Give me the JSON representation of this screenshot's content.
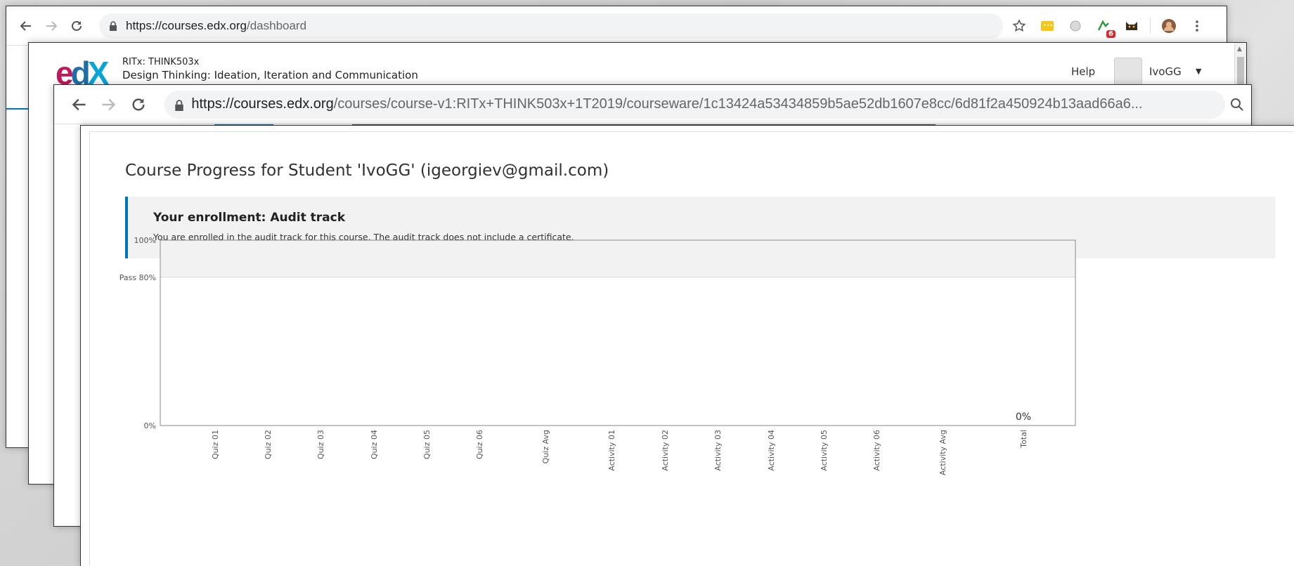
{
  "window1": {
    "url_host": "https://courses.edx.org",
    "url_path": "/dashboard"
  },
  "course_header": {
    "org_code": "RITx: THINK503x",
    "course_title": "Design Thinking: Ideation, Iteration and Communication",
    "help_label": "Help",
    "username": "IvoGG",
    "extension_badge": "6"
  },
  "window3": {
    "url_host": "https://courses.edx.org",
    "url_path": "/courses/course-v1:RITx+THINK503x+1T2019/courseware/1c13424a53434859b5ae52db1607e8cc/6d81f2a450924b13aad66a6..."
  },
  "progress_page": {
    "title": "Course Progress for Student 'IvoGG' (igeorgiev@gmail.com)",
    "enrollment_title": "Your enrollment: Audit track",
    "enrollment_text": "You are enrolled in the audit track for this course. The audit track does not include a certificate."
  },
  "chart_data": {
    "type": "bar",
    "categories": [
      "Quiz 01",
      "Quiz 02",
      "Quiz 03",
      "Quiz 04",
      "Quiz 05",
      "Quiz 06",
      "Quiz Avg",
      "Activity 01",
      "Activity 02",
      "Activity 03",
      "Activity 04",
      "Activity 05",
      "Activity 06",
      "Activity Avg",
      "Total"
    ],
    "values": [
      0,
      0,
      0,
      0,
      0,
      0,
      0,
      0,
      0,
      0,
      0,
      0,
      0,
      0,
      0
    ],
    "ylim": [
      0,
      100
    ],
    "yticks": [
      {
        "value": 100,
        "label": "100%"
      },
      {
        "value": 80,
        "label": "Pass 80%"
      },
      {
        "value": 0,
        "label": "0%"
      }
    ],
    "pass_threshold": 80,
    "total_label": "0%",
    "colors": {
      "pass_band": "#f2f2f2",
      "axis": "#888888"
    }
  }
}
